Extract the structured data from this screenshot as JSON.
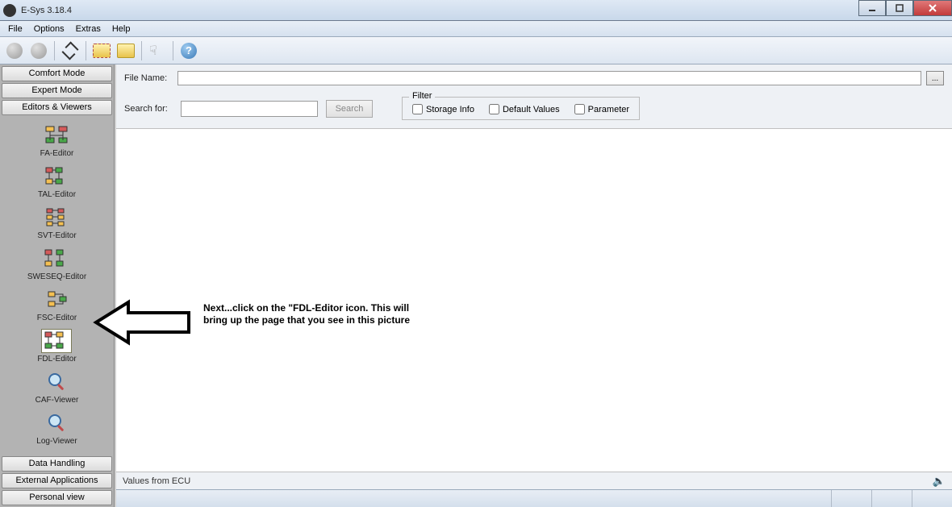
{
  "window": {
    "title": "E-Sys 3.18.4"
  },
  "menu": {
    "file": "File",
    "options": "Options",
    "extras": "Extras",
    "help": "Help"
  },
  "sidebar": {
    "comfort": "Comfort Mode",
    "expert": "Expert Mode",
    "editors": "Editors & Viewers",
    "items": [
      {
        "label": "FA-Editor"
      },
      {
        "label": "TAL-Editor"
      },
      {
        "label": "SVT-Editor"
      },
      {
        "label": "SWESEQ-Editor"
      },
      {
        "label": "FSC-Editor"
      },
      {
        "label": "FDL-Editor"
      },
      {
        "label": "CAF-Viewer"
      },
      {
        "label": "Log-Viewer"
      }
    ],
    "data_handling": "Data Handling",
    "external_apps": "External Applications",
    "personal": "Personal view"
  },
  "main": {
    "filename_label": "File Name:",
    "filename_value": "",
    "browse": "...",
    "search_label": "Search for:",
    "search_value": "",
    "search_btn": "Search",
    "filter_label": "Filter",
    "filter_storage": "Storage Info",
    "filter_default": "Default Values",
    "filter_parameter": "Parameter",
    "values_label": "Values from ECU"
  },
  "annotation": {
    "text": "Next...click on the \"FDL-Editor icon.  This will bring up the page that you see in this picture"
  }
}
